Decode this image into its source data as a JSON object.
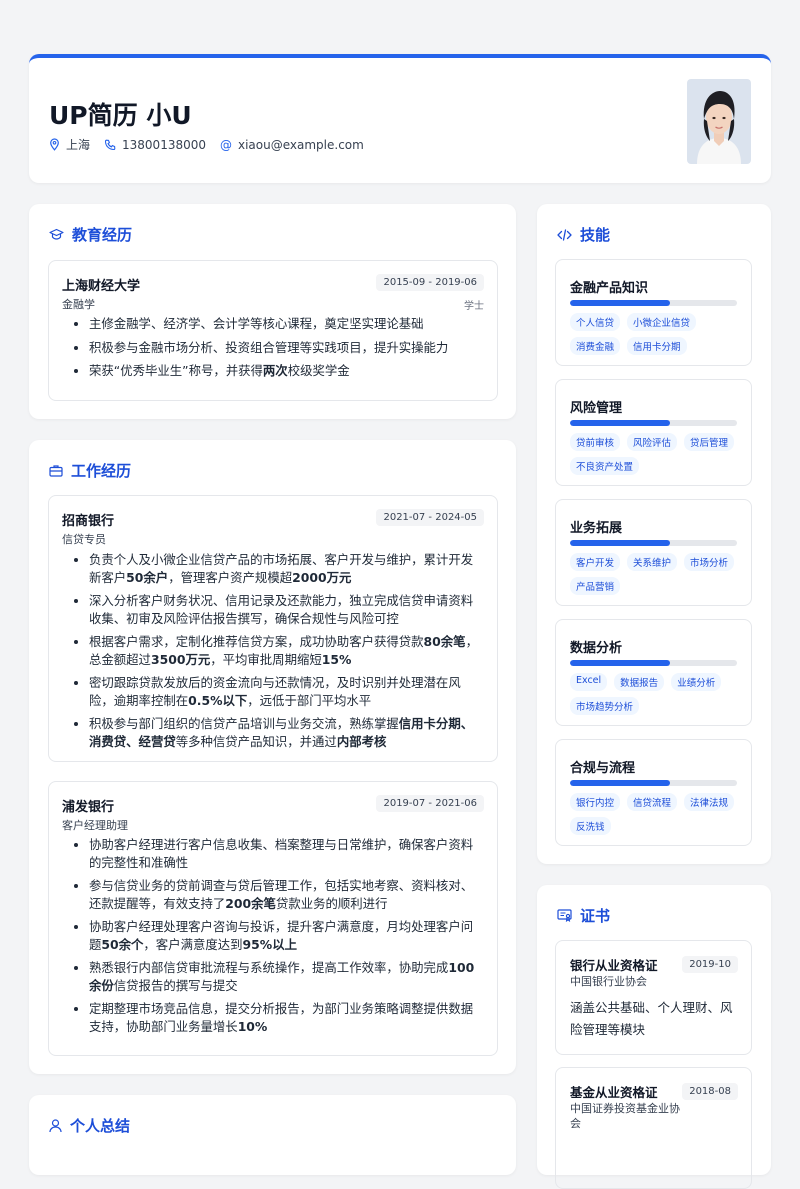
{
  "header": {
    "name": "UP简历 小U",
    "location": "上海",
    "phone": "13800138000",
    "email": "xiaou@example.com"
  },
  "education": {
    "title": "教育经历",
    "school": "上海财经大学",
    "date": "2015-09 - 2019-06",
    "major": "金融学",
    "degree": "学士",
    "bullets": [
      [
        {
          "t": "主修金融学、经济学、会计学等核心课程，奠定坚实理论基础",
          "b": false
        }
      ],
      [
        {
          "t": "积极参与金融市场分析、投资组合管理等实践项目，提升实操能力",
          "b": false
        }
      ],
      [
        {
          "t": "荣获“优秀毕业生”称号，并获得",
          "b": false
        },
        {
          "t": "两次",
          "b": true
        },
        {
          "t": "校级奖学金",
          "b": false
        }
      ]
    ]
  },
  "work": {
    "title": "工作经历",
    "jobs": [
      {
        "company": "招商银行",
        "date": "2021-07 - 2024-05",
        "role": "信贷专员",
        "bullets": [
          [
            {
              "t": "负责个人及小微企业信贷产品的市场拓展、客户开发与维护，累计开发新客户",
              "b": false
            },
            {
              "t": "50余户",
              "b": true
            },
            {
              "t": "，管理客户资产规模超",
              "b": false
            },
            {
              "t": "2000万元",
              "b": true
            }
          ],
          [
            {
              "t": "深入分析客户财务状况、信用记录及还款能力，独立完成信贷申请资料收集、初审及风险评估报告撰写，确保合规性与风险可控",
              "b": false
            }
          ],
          [
            {
              "t": "根据客户需求，定制化推荐信贷方案，成功协助客户获得贷款",
              "b": false
            },
            {
              "t": "80余笔",
              "b": true
            },
            {
              "t": "，总金额超过",
              "b": false
            },
            {
              "t": "3500万元",
              "b": true
            },
            {
              "t": "，平均审批周期缩短",
              "b": false
            },
            {
              "t": "15%",
              "b": true
            }
          ],
          [
            {
              "t": "密切跟踪贷款发放后的资金流向与还款情况，及时识别并处理潜在风险，逾期率控制在",
              "b": false
            },
            {
              "t": "0.5%以下",
              "b": true
            },
            {
              "t": "，远低于部门平均水平",
              "b": false
            }
          ],
          [
            {
              "t": "积极参与部门组织的信贷产品培训与业务交流，熟练掌握",
              "b": false
            },
            {
              "t": "信用卡分期、消费贷、经营贷",
              "b": true
            },
            {
              "t": "等多种信贷产品知识，并通过",
              "b": false
            },
            {
              "t": "内部考核",
              "b": true
            }
          ]
        ]
      },
      {
        "company": "浦发银行",
        "date": "2019-07 - 2021-06",
        "role": "客户经理助理",
        "bullets": [
          [
            {
              "t": "协助客户经理进行客户信息收集、档案整理与日常维护，确保客户资料的完整性和准确性",
              "b": false
            }
          ],
          [
            {
              "t": "参与信贷业务的贷前调查与贷后管理工作，包括实地考察、资料核对、还款提醒等，有效支持了",
              "b": false
            },
            {
              "t": "200余笔",
              "b": true
            },
            {
              "t": "贷款业务的顺利进行",
              "b": false
            }
          ],
          [
            {
              "t": "协助客户经理处理客户咨询与投诉，提升客户满意度，月均处理客户问题",
              "b": false
            },
            {
              "t": "50余个",
              "b": true
            },
            {
              "t": "，客户满意度达到",
              "b": false
            },
            {
              "t": "95%以上",
              "b": true
            }
          ],
          [
            {
              "t": "熟悉银行内部信贷审批流程与系统操作，提高工作效率，协助完成",
              "b": false
            },
            {
              "t": "100余份",
              "b": true
            },
            {
              "t": "信贷报告的撰写与提交",
              "b": false
            }
          ],
          [
            {
              "t": "定期整理市场竞品信息，提交分析报告，为部门业务策略调整提供数据支持，协助部门业务量增长",
              "b": false
            },
            {
              "t": "10%",
              "b": true
            }
          ]
        ]
      }
    ]
  },
  "summary": {
    "title": "个人总结"
  },
  "skills": {
    "title": "技能",
    "items": [
      {
        "name": "金融产品知识",
        "level": 0.6,
        "tags": [
          "个人信贷",
          "小微企业信贷",
          "消费金融",
          "信用卡分期"
        ]
      },
      {
        "name": "风险管理",
        "level": 0.6,
        "tags": [
          "贷前审核",
          "风险评估",
          "贷后管理",
          "不良资产处置"
        ]
      },
      {
        "name": "业务拓展",
        "level": 0.6,
        "tags": [
          "客户开发",
          "关系维护",
          "市场分析",
          "产品营销"
        ]
      },
      {
        "name": "数据分析",
        "level": 0.6,
        "tags": [
          "Excel",
          "数据报告",
          "业绩分析",
          "市场趋势分析"
        ]
      },
      {
        "name": "合规与流程",
        "level": 0.6,
        "tags": [
          "银行内控",
          "信贷流程",
          "法律法规",
          "反洗钱"
        ]
      }
    ]
  },
  "certificates": {
    "title": "证书",
    "items": [
      {
        "name": "银行从业资格证",
        "org": "中国银行业协会",
        "date": "2019-10",
        "desc": "涵盖公共基础、个人理财、风险管理等模块"
      },
      {
        "name": "基金从业资格证",
        "org": "中国证券投资基金业协会",
        "date": "2018-08"
      }
    ]
  },
  "colors": {
    "accent": "#2563eb",
    "heading": "#1d4ed8",
    "tag_bg": "#eff6ff"
  }
}
